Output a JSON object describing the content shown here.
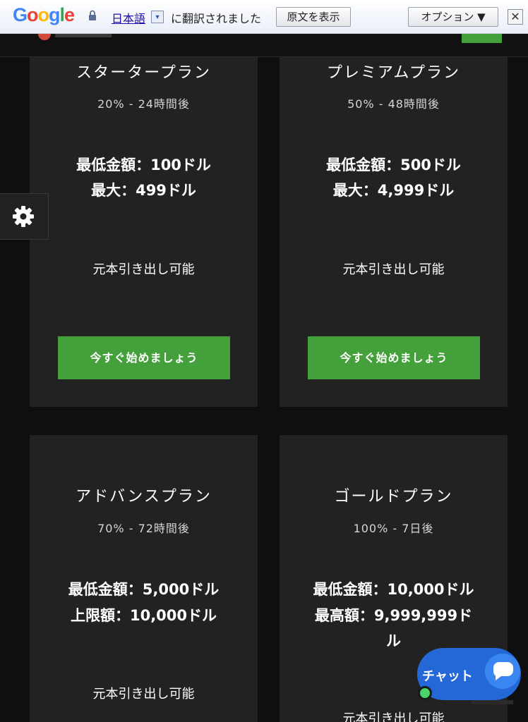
{
  "translate_bar": {
    "logo": "Google",
    "language": "日本語",
    "dropdown_symbol": "▾",
    "message": "に翻訳されました",
    "show_original": "原文を表示",
    "options": "オプション ▼",
    "close": "✕"
  },
  "cards": [
    {
      "title": "スタータープラン",
      "rate": "20% - 24時間後",
      "min": "最低金額：100ドル",
      "max": "最大：499ドル",
      "note": "元本引き出し可能",
      "button": "今すぐ始めましょう"
    },
    {
      "title": "プレミアムプラン",
      "rate": "50% - 48時間後",
      "min": "最低金額：500ドル",
      "max": "最大：4,999ドル",
      "note": "元本引き出し可能",
      "button": "今すぐ始めましょう"
    },
    {
      "title": "アドバンスプラン",
      "rate": "70% - 72時間後",
      "min": "最低金額：5,000ドル",
      "max": "上限額：10,000ドル",
      "note": "元本引き出し可能"
    },
    {
      "title": "ゴールドプラン",
      "rate": "100% - 7日後",
      "min": "最低金額：10,000ドル",
      "max": "最高額：9,999,999ドル",
      "note": "元本引き出し可能"
    }
  ],
  "chat": {
    "label": "チャット"
  },
  "icons": [
    "lock-icon",
    "gear-icon",
    "chat-bubble-icon"
  ],
  "colors": {
    "accent_green": "#44a03a",
    "card_bg": "#222222",
    "chat_blue": "#2468d8"
  }
}
